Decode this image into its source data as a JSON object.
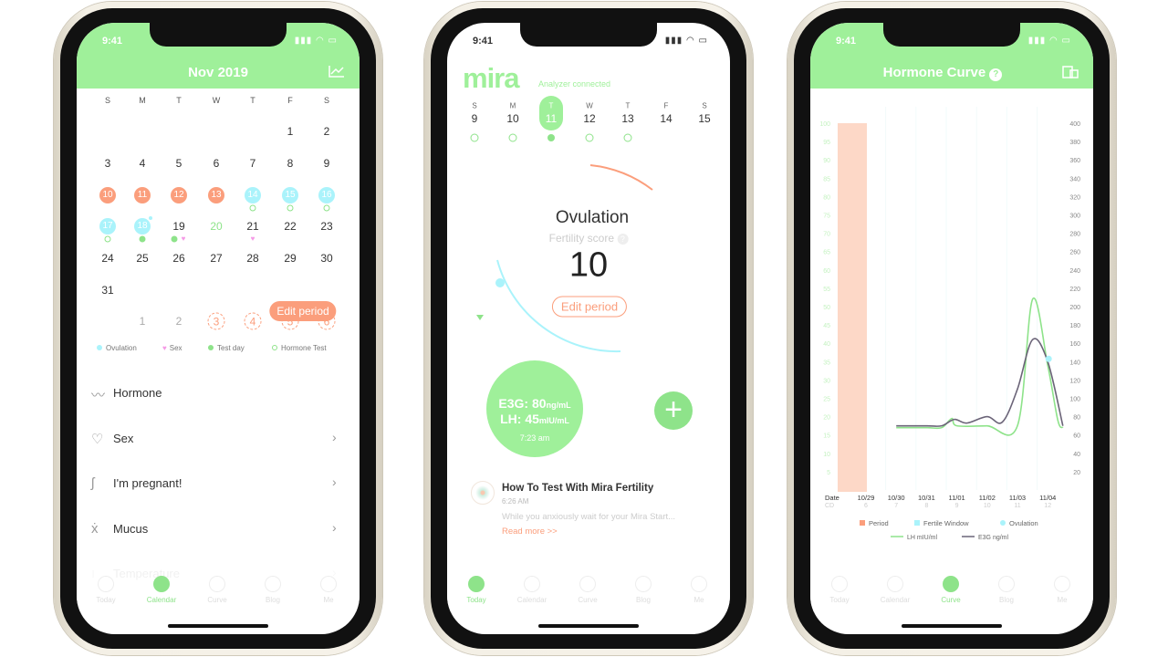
{
  "status": {
    "time": "9:41"
  },
  "colors": {
    "green": "#9ff09a",
    "period": "#fb9e7c",
    "fertile": "#aaf3fb",
    "heart": "#f59ae6",
    "e3g": "#6b6478"
  },
  "calendar": {
    "title": "Nov 2019",
    "header_icon": "line-chart-icon",
    "weekdays": [
      "S",
      "M",
      "T",
      "W",
      "T",
      "F",
      "S"
    ],
    "start_weekday": 5,
    "days": [
      {
        "d": "1"
      },
      {
        "d": "2"
      },
      {
        "d": "3"
      },
      {
        "d": "4"
      },
      {
        "d": "5"
      },
      {
        "d": "6"
      },
      {
        "d": "7"
      },
      {
        "d": "8"
      },
      {
        "d": "9"
      },
      {
        "d": "10",
        "state": "period"
      },
      {
        "d": "11",
        "state": "period"
      },
      {
        "d": "12",
        "state": "period"
      },
      {
        "d": "13",
        "state": "period"
      },
      {
        "d": "14",
        "state": "fertile",
        "marks": [
          "hormone-test"
        ]
      },
      {
        "d": "15",
        "state": "fertile",
        "marks": [
          "hormone-test"
        ]
      },
      {
        "d": "16",
        "state": "fertile",
        "marks": [
          "hormone-test"
        ]
      },
      {
        "d": "17",
        "state": "fertile",
        "marks": [
          "hormone-test"
        ]
      },
      {
        "d": "18",
        "state": "ovulation",
        "marks": [
          "test-day"
        ]
      },
      {
        "d": "19",
        "marks": [
          "test-day",
          "sex"
        ]
      },
      {
        "d": "20",
        "state": "today"
      },
      {
        "d": "21",
        "marks": [
          "sex"
        ]
      },
      {
        "d": "22"
      },
      {
        "d": "23"
      },
      {
        "d": "24"
      },
      {
        "d": "25"
      },
      {
        "d": "26"
      },
      {
        "d": "27"
      },
      {
        "d": "28"
      },
      {
        "d": "29"
      },
      {
        "d": "30"
      },
      {
        "d": "31"
      }
    ],
    "next_days": [
      {
        "d": "1"
      },
      {
        "d": "2"
      },
      {
        "d": "3",
        "state": "predicted"
      },
      {
        "d": "4",
        "state": "predicted"
      },
      {
        "d": "5",
        "state": "predicted"
      },
      {
        "d": "6",
        "state": "predicted"
      }
    ],
    "edit_period": "Edit period",
    "legend": [
      {
        "label": "Ovulation",
        "icon": "ovulation-icon"
      },
      {
        "label": "Sex",
        "icon": "heart-icon"
      },
      {
        "label": "Test day",
        "icon": "test-day-icon"
      },
      {
        "label": "Hormone Test",
        "icon": "hormone-test-icon"
      }
    ],
    "list": [
      {
        "label": "Hormone",
        "icon": "hormone-icon"
      },
      {
        "label": "Sex",
        "icon": "heart-outline-icon"
      },
      {
        "label": "I'm pregnant!",
        "icon": "pregnant-icon"
      },
      {
        "label": "Mucus",
        "icon": "mucus-icon"
      },
      {
        "label": "Temperature",
        "icon": "thermometer-icon"
      }
    ]
  },
  "tabs": [
    "Today",
    "Calendar",
    "Curve",
    "Blog",
    "Me"
  ],
  "today": {
    "brand": "mira",
    "connection": "Analyzer connected",
    "week": [
      {
        "w": "S",
        "d": "9",
        "dot": "ring"
      },
      {
        "w": "M",
        "d": "10",
        "dot": "ring"
      },
      {
        "w": "T",
        "d": "11",
        "dot": "fill",
        "selected": true
      },
      {
        "w": "W",
        "d": "12",
        "dot": "ring"
      },
      {
        "w": "T",
        "d": "13",
        "dot": "ring"
      },
      {
        "w": "F",
        "d": "14"
      },
      {
        "w": "S",
        "d": "15"
      }
    ],
    "phase": "Ovulation",
    "score_label": "Fertility score",
    "score": "10",
    "edit_period": "Edit period",
    "e3g_label": "E3G: ",
    "e3g_value": "80",
    "e3g_unit": "ng/mL",
    "lh_label": "LH: ",
    "lh_value": "45",
    "lh_unit": "mIU/mL",
    "time": "7:23 am",
    "article": {
      "title": "How To Test With Mira Fertility",
      "time": "6:26 AM",
      "excerpt": "While you anxiously wait for your Mira Start...",
      "link": "Read more >>"
    }
  },
  "curve": {
    "title": "Hormone Curve",
    "help": "?",
    "header_icon": "devices-icon"
  },
  "chart_data": {
    "type": "line",
    "x_categories": [
      "10/29",
      "10/30",
      "10/31",
      "11/01",
      "11/02",
      "11/03",
      "11/04"
    ],
    "cd": [
      "6",
      "7",
      "8",
      "9",
      "10",
      "11",
      "12"
    ],
    "x_row_labels": [
      "Date",
      "CD"
    ],
    "y_left": {
      "range": [
        0,
        100
      ],
      "ticks": [
        5,
        10,
        15,
        20,
        25,
        30,
        35,
        40,
        45,
        50,
        55,
        60,
        65,
        70,
        75,
        80,
        85,
        90,
        95,
        100
      ]
    },
    "y_right": {
      "range": [
        0,
        400
      ],
      "ticks": [
        20,
        40,
        60,
        80,
        100,
        120,
        140,
        160,
        180,
        200,
        220,
        240,
        260,
        280,
        300,
        320,
        340,
        360,
        380,
        400
      ]
    },
    "period": [
      "10/29"
    ],
    "ovulation_marker": {
      "x": "11/04 00:00",
      "y_right": 143
    },
    "series": [
      {
        "name": "LH mIU/ml",
        "axis": "left",
        "color": "#8ee38a",
        "points": [
          [
            "10/30 00:00",
            17
          ],
          [
            "10/31 00:00",
            17
          ],
          [
            "10/31 12:00",
            17
          ],
          [
            "10/31 20:00",
            19.5
          ],
          [
            "11/01 00:00",
            17.5
          ],
          [
            "11/02 00:00",
            17.5
          ],
          [
            "11/03 00:00",
            17.5
          ],
          [
            "11/03 12:00",
            52
          ],
          [
            "11/04 00:00",
            34
          ],
          [
            "11/04 08:00",
            19
          ],
          [
            "11/04 12:00",
            17
          ]
        ]
      },
      {
        "name": "E3G ng/ml",
        "axis": "right",
        "color": "#6b6478",
        "points": [
          [
            "10/30 00:00",
            70
          ],
          [
            "10/31 00:00",
            70
          ],
          [
            "10/31 12:00",
            70
          ],
          [
            "10/31 22:00",
            77
          ],
          [
            "11/01 08:00",
            73
          ],
          [
            "11/02 00:00",
            80
          ],
          [
            "11/02 12:00",
            74
          ],
          [
            "11/03 00:00",
            110
          ],
          [
            "11/03 12:00",
            164
          ],
          [
            "11/04 00:00",
            140
          ],
          [
            "11/04 12:00",
            70
          ]
        ]
      }
    ],
    "legend": [
      {
        "label": "Period",
        "color": "#fb9e7c"
      },
      {
        "label": "Fertile Window",
        "color": "#aaf3fb"
      },
      {
        "label": "Ovulation",
        "color": "#aaf3fb"
      }
    ]
  }
}
